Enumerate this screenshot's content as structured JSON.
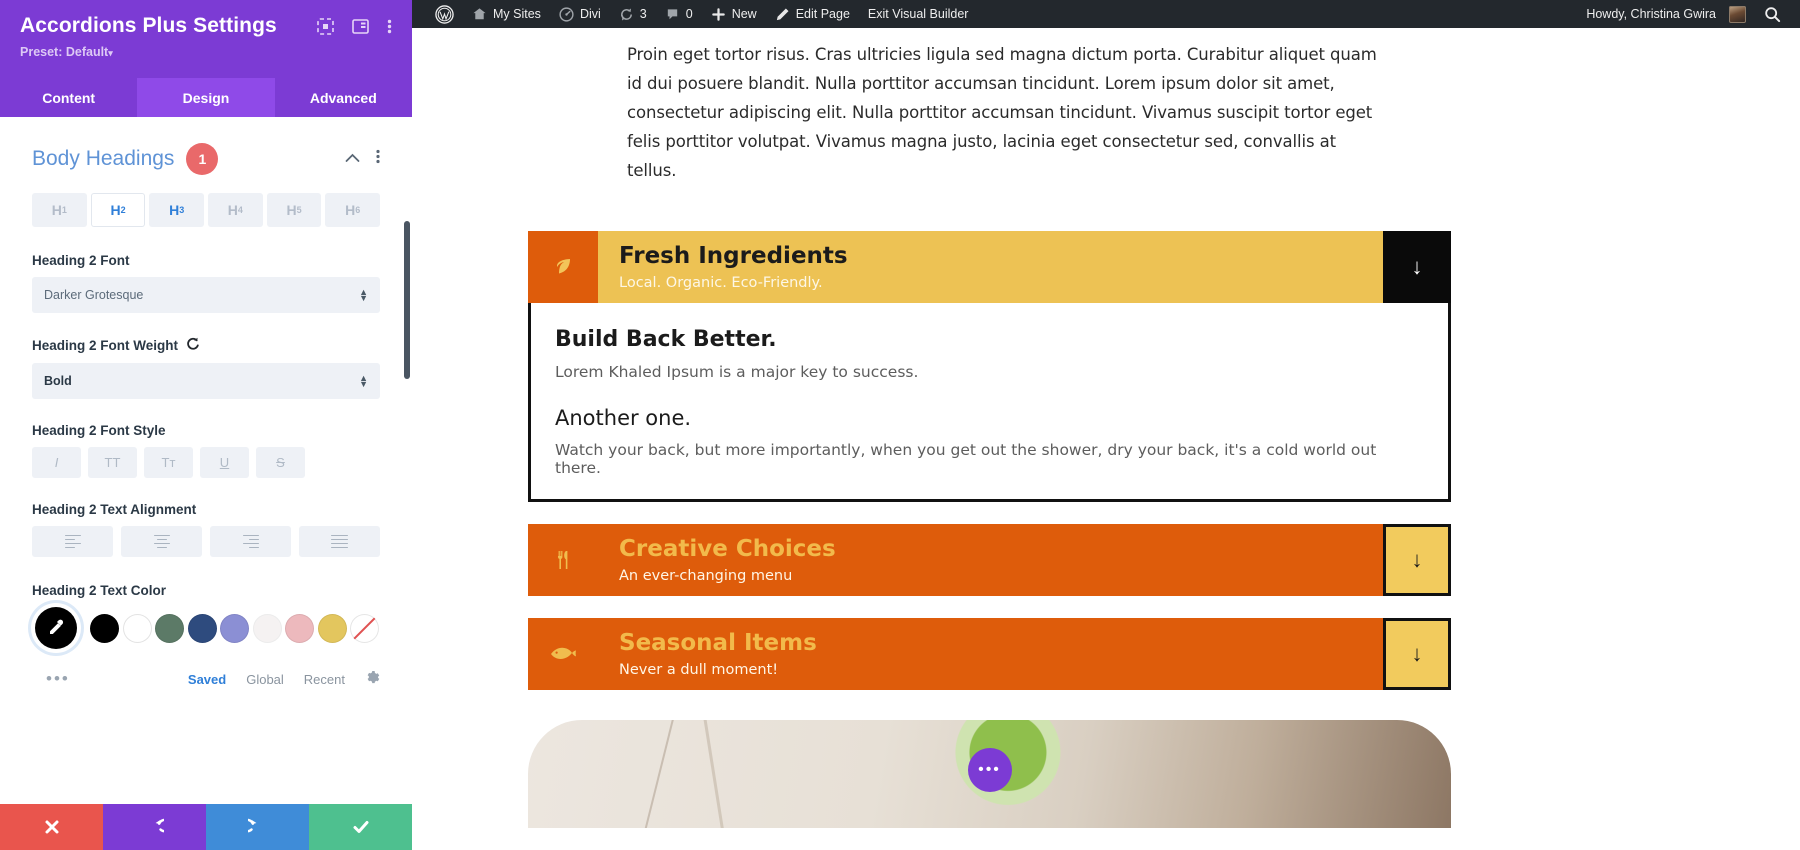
{
  "settings": {
    "title": "Accordions Plus Settings",
    "preset": "Preset: Default",
    "preset_caret": "▾",
    "icons": {
      "responsive": "responsive-view-icon",
      "layout": "panel-layout-icon",
      "more": "more-options-icon"
    },
    "tabs": [
      {
        "label": "Content",
        "active": false
      },
      {
        "label": "Design",
        "active": true
      },
      {
        "label": "Advanced",
        "active": false
      }
    ],
    "section": {
      "title": "Body Headings",
      "badge": "1",
      "collapse_icon": "chevron-up-icon",
      "options_icon": "kebab-menu-icon"
    },
    "heading_levels": [
      {
        "label": "H",
        "sub": "1",
        "state": "off"
      },
      {
        "label": "H",
        "sub": "2",
        "state": "active"
      },
      {
        "label": "H",
        "sub": "3",
        "state": "on"
      },
      {
        "label": "H",
        "sub": "4",
        "state": "off"
      },
      {
        "label": "H",
        "sub": "5",
        "state": "off"
      },
      {
        "label": "H",
        "sub": "6",
        "state": "off"
      }
    ],
    "fields": {
      "font_label": "Heading 2 Font",
      "font_value": "Darker Grotesque",
      "weight_label": "Heading 2 Font Weight",
      "weight_value": "Bold",
      "weight_reset_icon": "reset-icon",
      "style_label": "Heading 2 Font Style",
      "style_buttons": [
        "I",
        "TT",
        "Tᴛ",
        "U",
        "S"
      ],
      "align_label": "Heading 2 Text Alignment",
      "align_buttons": [
        "align-left-icon",
        "align-center-icon",
        "align-right-icon",
        "align-justify-icon"
      ],
      "color_label": "Heading 2 Text Color"
    },
    "swatches": [
      {
        "name": "eyedropper",
        "color": "#000000"
      },
      {
        "name": "black",
        "color": "#000000"
      },
      {
        "name": "white",
        "color": "#ffffff"
      },
      {
        "name": "sage-green",
        "color": "#5c7a67"
      },
      {
        "name": "navy-blue",
        "color": "#2e4b7e"
      },
      {
        "name": "periwinkle",
        "color": "#8b8fd4"
      },
      {
        "name": "off-white",
        "color": "#f5f2f2"
      },
      {
        "name": "dusty-pink",
        "color": "#edb9bd"
      },
      {
        "name": "mustard",
        "color": "#e3c65e"
      },
      {
        "name": "none",
        "color": "transparent"
      }
    ],
    "color_footer": {
      "more": "•••",
      "saved": "Saved",
      "global": "Global",
      "recent": "Recent",
      "gear": "gear-icon"
    },
    "footer_buttons": [
      {
        "name": "cancel",
        "glyph": "✖"
      },
      {
        "name": "undo",
        "glyph": "↺"
      },
      {
        "name": "redo",
        "glyph": "↻"
      },
      {
        "name": "save",
        "glyph": "✔"
      }
    ]
  },
  "admin_bar": {
    "wp_logo": "wordpress-logo-icon",
    "items": [
      {
        "label": "My Sites",
        "icon": "sites-icon"
      },
      {
        "label": "Divi",
        "icon": "divi-dashboard-icon"
      },
      {
        "label": "3",
        "icon": "updates-icon"
      },
      {
        "label": "0",
        "icon": "comments-icon"
      },
      {
        "label": "New",
        "icon": "plus-icon"
      },
      {
        "label": "Edit Page",
        "icon": "pencil-icon"
      },
      {
        "label": "Exit Visual Builder",
        "icon": ""
      }
    ],
    "howdy": "Howdy, Christina Gwira",
    "search_icon": "search-icon"
  },
  "page": {
    "paragraph": "Proin eget tortor risus. Cras ultricies ligula sed magna dictum porta. Curabitur aliquet quam id dui posuere blandit. Nulla porttitor accumsan tincidunt. Lorem ipsum dolor sit amet, consectetur adipiscing elit. Nulla porttitor accumsan tincidunt. Vivamus suscipit tortor eget felis porttitor volutpat. Vivamus magna justo, lacinia eget consectetur sed, convallis at tellus.",
    "accordions": [
      {
        "title": "Fresh Ingredients",
        "subtitle": "Local. Organic. Eco-Friendly.",
        "icon": "leaf-icon",
        "icon_glyph": "🍃",
        "toggle_glyph": "↓",
        "open": true,
        "body": {
          "heading1": "Build Back Better.",
          "text1": "Lorem Khaled Ipsum is a major key to success.",
          "heading2": "Another one.",
          "text2": "Watch your back, but more importantly, when you get out the shower, dry your back, it's a cold world out there."
        }
      },
      {
        "title": "Creative Choices",
        "subtitle": "An ever-changing menu",
        "icon": "fork-knife-icon",
        "icon_glyph": "🍽",
        "toggle_glyph": "↓",
        "open": false
      },
      {
        "title": "Seasonal Items",
        "subtitle": "Never a dull moment!",
        "icon": "fish-icon",
        "icon_glyph": "🐟",
        "toggle_glyph": "↓",
        "open": false
      }
    ],
    "floating_dots": "•••"
  }
}
